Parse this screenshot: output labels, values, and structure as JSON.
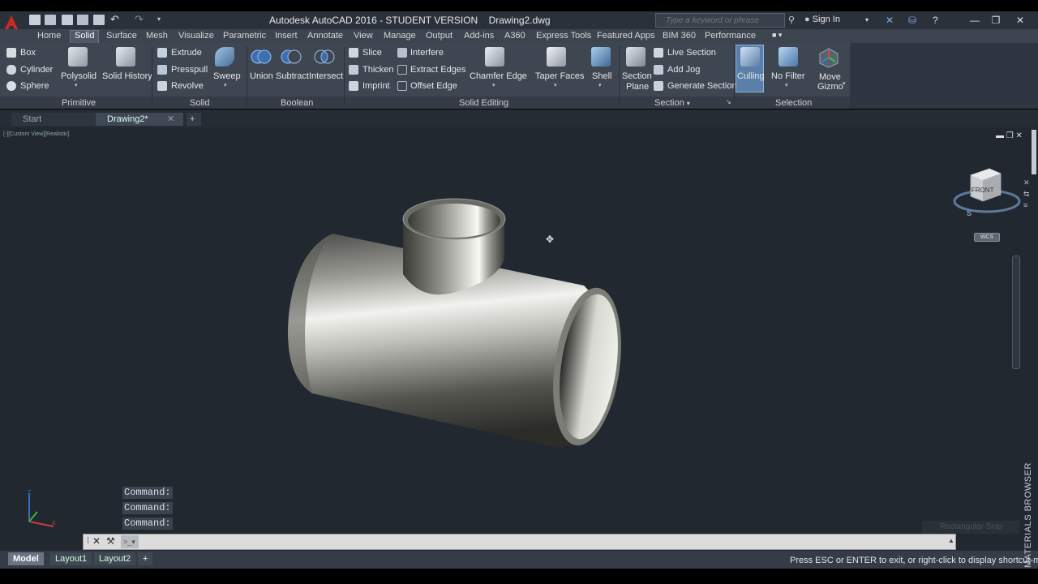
{
  "title": {
    "app": "Autodesk AutoCAD 2016 - STUDENT VERSION",
    "file": "Drawing2.dwg",
    "search_placeholder": "Type a keyword or phrase",
    "signin": "Sign In"
  },
  "menu_tabs": [
    "Home",
    "Solid",
    "Surface",
    "Mesh",
    "Visualize",
    "Parametric",
    "Insert",
    "Annotate",
    "View",
    "Manage",
    "Output",
    "Add-ins",
    "A360",
    "Express Tools",
    "Featured Apps",
    "BIM 360",
    "Performance"
  ],
  "ribbon": {
    "primitive": {
      "title": "Primitive",
      "box": "Box",
      "cylinder": "Cylinder",
      "sphere": "Sphere",
      "polysolid": "Polysolid",
      "solid_history": "Solid History"
    },
    "solid": {
      "title": "Solid",
      "extrude": "Extrude",
      "presspull": "Presspull",
      "revolve": "Revolve",
      "sweep": "Sweep"
    },
    "boolean": {
      "title": "Boolean",
      "union": "Union",
      "subtract": "Subtract",
      "intersect": "Intersect"
    },
    "solid_editing": {
      "title": "Solid Editing",
      "slice": "Slice",
      "thicken": "Thicken",
      "imprint": "Imprint",
      "interfere": "Interfere",
      "extract_edges": "Extract Edges",
      "offset_edge": "Offset Edge",
      "chamfer_edge": "Chamfer Edge",
      "taper_faces": "Taper Faces",
      "shell": "Shell"
    },
    "section": {
      "title": "Section",
      "section_plane_1": "Section",
      "section_plane_2": "Plane",
      "live_section": "Live Section",
      "add_jog": "Add Jog",
      "generate_section": "Generate Section"
    },
    "selection": {
      "title": "Selection",
      "culling": "Culling",
      "no_filter": "No Filter",
      "move_gizmo_1": "Move",
      "move_gizmo_2": "Gizmo"
    }
  },
  "file_tabs": {
    "start": "Start",
    "drawing": "Drawing2*"
  },
  "viewport": {
    "label": "[-][Custom View][Realistic]",
    "viewcube_front": "FRONT",
    "wcs": "WCS",
    "compass_n": "S",
    "ghost_text": "Rectangular Snip"
  },
  "command": {
    "history": [
      "Command:",
      "Command:",
      "Command:"
    ],
    "input_value": ""
  },
  "layout_tabs": [
    "Model",
    "Layout1",
    "Layout2"
  ],
  "status_message": "Press ESC or ENTER to exit, or right-click to display shortcut-me",
  "side_palette": "MATERIALS BROWSER",
  "colors": {
    "accent_red": "#c8281e",
    "viewport_bg": "#212830",
    "ribbon_bg": "#3e4652",
    "selected_tool": "#5a7fa8"
  }
}
